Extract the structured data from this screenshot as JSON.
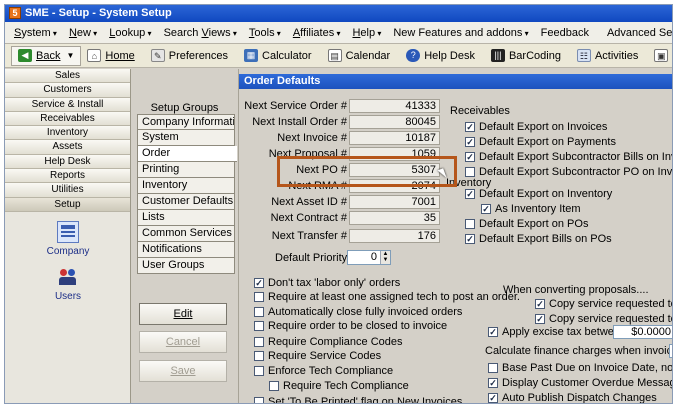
{
  "window": {
    "title": "SME - Setup - System Setup"
  },
  "menu": {
    "items": [
      {
        "pre": "",
        "key": "S",
        "rest": "ystem",
        "suffix": " ▾"
      },
      {
        "pre": "",
        "key": "N",
        "rest": "ew",
        "suffix": " ▾"
      },
      {
        "pre": "",
        "key": "L",
        "rest": "ookup",
        "suffix": " ▾"
      },
      {
        "pre": "Search ",
        "key": "V",
        "rest": "iews",
        "suffix": " ▾"
      },
      {
        "pre": "",
        "key": "T",
        "rest": "ools",
        "suffix": " ▾"
      },
      {
        "pre": "",
        "key": "A",
        "rest": "ffiliates",
        "suffix": " ▾"
      },
      {
        "pre": "",
        "key": "H",
        "rest": "elp",
        "suffix": " ▾"
      },
      {
        "pre": "New Features and addons",
        "key": "",
        "rest": "",
        "suffix": " ▾"
      },
      {
        "pre": "Feedback",
        "key": "",
        "rest": "",
        "suffix": ""
      }
    ],
    "advanced_search": "Advanced Search"
  },
  "toolbar": {
    "back": "Back",
    "home": "Home",
    "preferences": "Preferences",
    "calculator": "Calculator",
    "calendar": "Calendar",
    "help_desk": "Help Desk",
    "barcoding": "BarCoding",
    "activities": "Activities",
    "dispatch": "Di"
  },
  "nav": {
    "items": [
      "Sales",
      "Customers",
      "Service & Install",
      "Receivables",
      "Inventory",
      "Assets",
      "Help Desk",
      "Reports",
      "Utilities",
      "Setup"
    ],
    "active_index": 9,
    "tiles": [
      {
        "label": "Company",
        "icon": "company-icon"
      },
      {
        "label": "Users",
        "icon": "users-icon"
      }
    ]
  },
  "groups": {
    "title": "Setup Groups",
    "items": [
      "Company Information",
      "System",
      "Order",
      "Printing",
      "Inventory",
      "Customer Defaults",
      "Lists",
      "Common Services",
      "Notifications",
      "User Groups"
    ],
    "active_index": 2,
    "buttons": {
      "edit": "Edit",
      "cancel": "Cancel",
      "save": "Save"
    }
  },
  "order_defaults": {
    "header": "Order Defaults",
    "fields": [
      {
        "label": "Next Service Order #",
        "value": "41333"
      },
      {
        "label": "Next Install Order #",
        "value": "80045"
      },
      {
        "label": "Next Invoice #",
        "value": "10187"
      },
      {
        "label": "Next Proposal #",
        "value": "1059"
      },
      {
        "label": "Next PO #",
        "value": "5307"
      },
      {
        "label": "Next RMA #",
        "value": "2074"
      },
      {
        "label": "Next Asset ID #",
        "value": "7001"
      },
      {
        "label": "Next Contract #",
        "value": "35"
      },
      {
        "label": "Next Transfer #",
        "value": "176"
      }
    ],
    "default_priority": {
      "label": "Default Priority",
      "value": "0"
    },
    "receivables": {
      "title": "Receivables",
      "options": [
        {
          "label": "Default Export on Invoices",
          "checked": true
        },
        {
          "label": "Default Export on Payments",
          "checked": true
        },
        {
          "label": "Default Export Subcontractor Bills on Invoices",
          "checked": true
        },
        {
          "label": "Default Export Subcontractor PO on Invoices",
          "checked": false
        }
      ]
    },
    "inventory": {
      "title": "Inventory",
      "options": [
        {
          "label": "Default Export on Inventory",
          "checked": true
        },
        {
          "label": "As Inventory Item",
          "checked": true
        },
        {
          "label": "Default Export on POs",
          "checked": false
        },
        {
          "label": "Default Export Bills on POs",
          "checked": true
        }
      ]
    },
    "general_options": [
      {
        "label": "Don't tax 'labor only' orders",
        "checked": true
      },
      {
        "label": "Require at least one assigned tech to post an order.",
        "checked": false
      },
      {
        "label": "Automatically close fully invoiced orders",
        "checked": false
      },
      {
        "label": "Require order to be closed to invoice",
        "checked": false
      },
      {
        "label": "Require Compliance Codes",
        "checked": false
      },
      {
        "label": "Require Service Codes",
        "checked": false
      },
      {
        "label": "Enforce Tech Compliance",
        "checked": false
      },
      {
        "label": "Require Tech Compliance",
        "checked": false
      },
      {
        "label": "Set 'To Be Printed' flag on New Invoices",
        "checked": false
      }
    ],
    "proposals": {
      "title": "When converting proposals....",
      "options": [
        {
          "label": "Copy service requested to ser",
          "checked": true
        },
        {
          "label": "Copy service requested to ser",
          "checked": true
        }
      ]
    },
    "excise": {
      "label": "Apply excise tax between",
      "checked": true,
      "value": "$0.0000"
    },
    "finance": {
      "label": "Calculate finance charges when invoice is",
      "options": [
        {
          "label": "Base Past Due on Invoice Date, not Due D",
          "checked": false
        },
        {
          "label": "Display Customer Overdue Message",
          "checked": true
        },
        {
          "label": "Auto Publish Dispatch Changes",
          "checked": true
        }
      ]
    }
  }
}
